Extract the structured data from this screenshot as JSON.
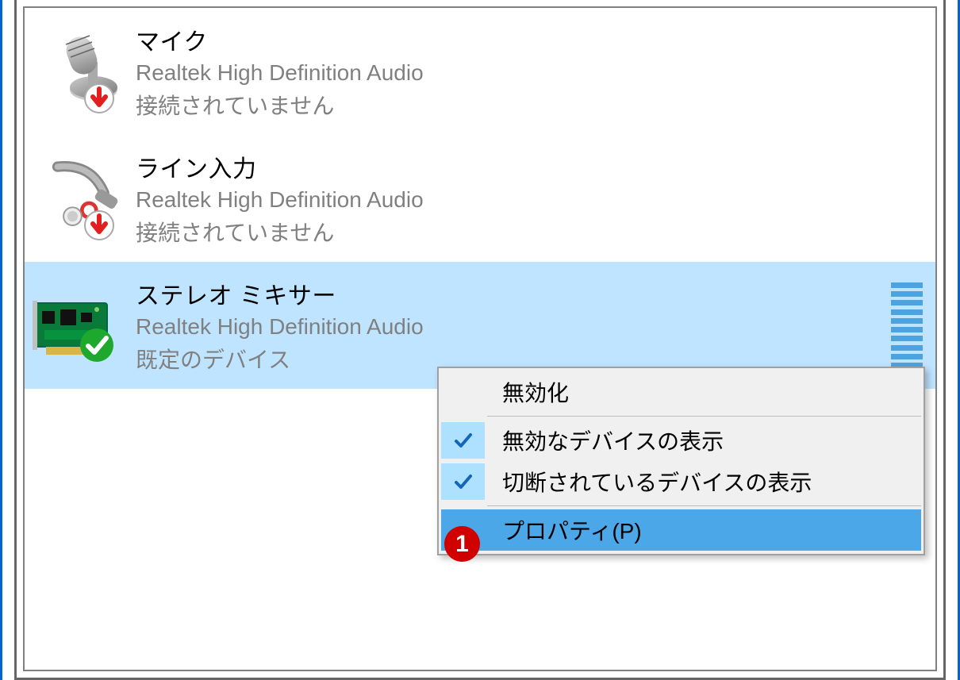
{
  "devices": [
    {
      "name": "マイク",
      "description": "Realtek High Definition Audio",
      "status": "接続されていません",
      "badge": "disconnected",
      "icon": "mic"
    },
    {
      "name": "ライン入力",
      "description": "Realtek High Definition Audio",
      "status": "接続されていません",
      "badge": "disconnected",
      "icon": "line-in"
    },
    {
      "name": "ステレオ ミキサー",
      "description": "Realtek High Definition Audio",
      "status": "既定のデバイス",
      "badge": "default",
      "icon": "sound-card",
      "selected": true
    }
  ],
  "context_menu": {
    "items": [
      {
        "label": "無効化",
        "checked": false,
        "highlighted": false
      },
      {
        "label": "無効なデバイスの表示",
        "checked": true,
        "highlighted": false
      },
      {
        "label": "切断されているデバイスの表示",
        "checked": true,
        "highlighted": false
      },
      {
        "label": "プロパティ(P)",
        "checked": false,
        "highlighted": true
      }
    ],
    "separators_after": [
      0,
      2
    ]
  },
  "callout_number": "1",
  "colors": {
    "selection": "#bfe4ff",
    "menu_highlight": "#4ba7e8",
    "checked_bg": "#aee1ff",
    "callout": "#d10000"
  }
}
